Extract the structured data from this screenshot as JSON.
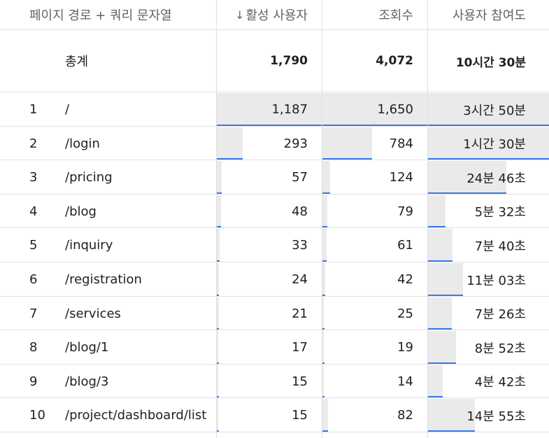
{
  "columns": {
    "dimension": "페이지 경로 + 쿼리 문자열",
    "sort_arrow": "↓",
    "users": "활성 사용자",
    "views": "조회수",
    "engagement": "사용자 참여도"
  },
  "totals": {
    "label": "총계",
    "users": "1,790",
    "views": "4,072",
    "engagement": "10시간 30분"
  },
  "rows": [
    {
      "index": "1",
      "path": "/",
      "users": "1,187",
      "views": "1,650",
      "engagement": "3시간 50분",
      "users_fill": 1.0,
      "views_fill": 1.0,
      "eng_fill": 1.0
    },
    {
      "index": "2",
      "path": "/login",
      "users": "293",
      "views": "784",
      "engagement": "1시간 30분",
      "users_fill": 0.247,
      "views_fill": 0.475,
      "eng_fill": 1.0
    },
    {
      "index": "3",
      "path": "/pricing",
      "users": "57",
      "views": "124",
      "engagement": "24분 46초",
      "users_fill": 0.048,
      "views_fill": 0.075,
      "eng_fill": 0.65
    },
    {
      "index": "4",
      "path": "/blog",
      "users": "48",
      "views": "79",
      "engagement": "5분 32초",
      "users_fill": 0.04,
      "views_fill": 0.048,
      "eng_fill": 0.145
    },
    {
      "index": "5",
      "path": "/inquiry",
      "users": "33",
      "views": "61",
      "engagement": "7분 40초",
      "users_fill": 0.028,
      "views_fill": 0.037,
      "eng_fill": 0.2
    },
    {
      "index": "6",
      "path": "/registration",
      "users": "24",
      "views": "42",
      "engagement": "11분 03초",
      "users_fill": 0.02,
      "views_fill": 0.025,
      "eng_fill": 0.29
    },
    {
      "index": "7",
      "path": "/services",
      "users": "21",
      "views": "25",
      "engagement": "7분 26초",
      "users_fill": 0.018,
      "views_fill": 0.015,
      "eng_fill": 0.195
    },
    {
      "index": "8",
      "path": "/blog/1",
      "users": "17",
      "views": "19",
      "engagement": "8분 52초",
      "users_fill": 0.014,
      "views_fill": 0.012,
      "eng_fill": 0.232
    },
    {
      "index": "9",
      "path": "/blog/3",
      "users": "15",
      "views": "14",
      "engagement": "4분 42초",
      "users_fill": 0.013,
      "views_fill": 0.008,
      "eng_fill": 0.123
    },
    {
      "index": "10",
      "path": "/project/dashboard/list",
      "users": "15",
      "views": "82",
      "engagement": "14분 55초",
      "users_fill": 0.013,
      "views_fill": 0.05,
      "eng_fill": 0.39
    }
  ],
  "colors": {
    "bar_fill": "#eaeaea",
    "bar_line": "#3b78e7",
    "grid": "#e0e0e0",
    "header_text": "#5f6368"
  }
}
